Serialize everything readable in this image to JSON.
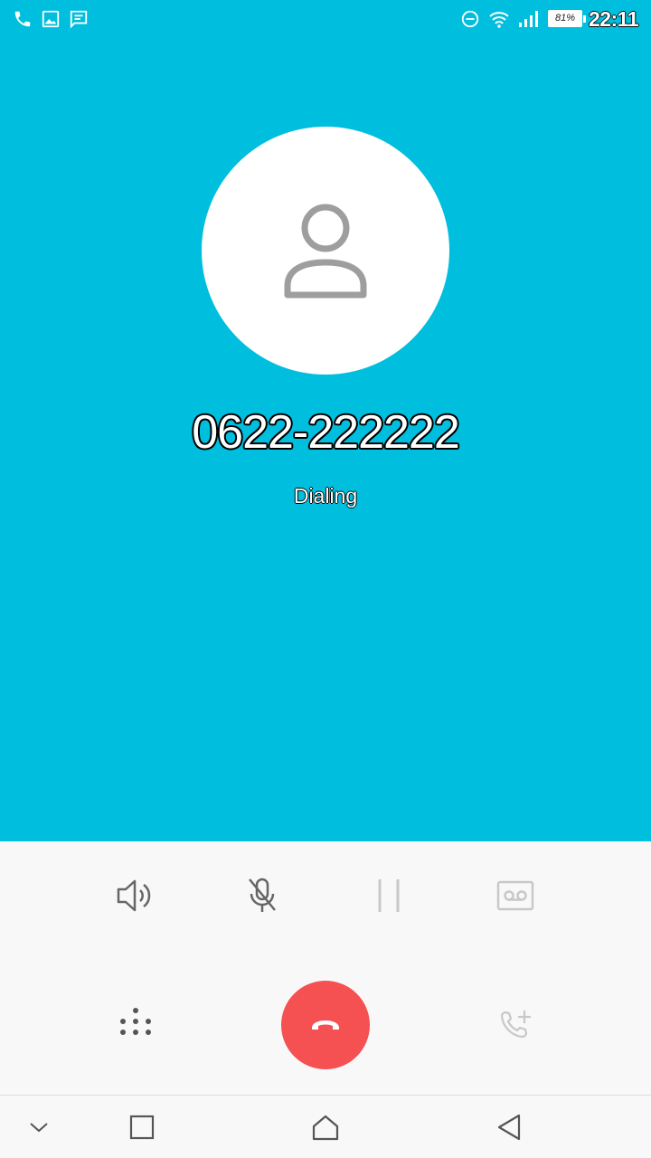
{
  "status_bar": {
    "time": "22:11",
    "battery": "81%",
    "left_icons": [
      "phone-icon",
      "image-icon",
      "message-icon"
    ],
    "right_icons": [
      "do-not-disturb-icon",
      "wifi-icon",
      "signal-icon",
      "battery-icon"
    ]
  },
  "call": {
    "number": "0622-222222",
    "status": "Dialing",
    "background_color": "#00bedd"
  },
  "controls": {
    "row1": [
      "speaker-icon",
      "mute-icon",
      "hold-icon",
      "record-icon"
    ],
    "row2": [
      "dialpad-icon",
      "end-call-button",
      "add-call-icon"
    ],
    "end_call_color": "#f55052"
  },
  "nav_bar": [
    "chevron-down-icon",
    "recents-icon",
    "home-icon",
    "back-icon"
  ]
}
